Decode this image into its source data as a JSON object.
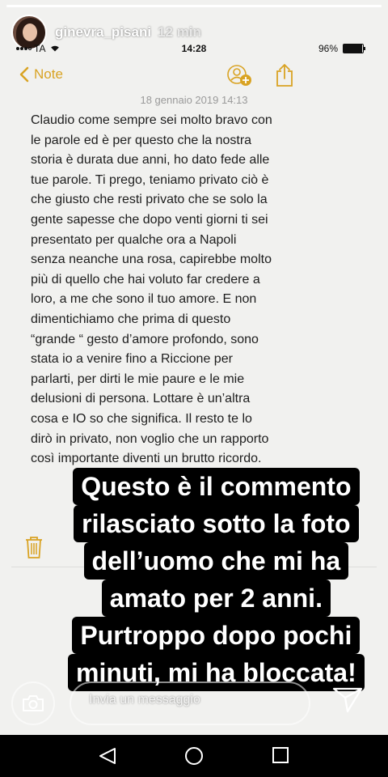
{
  "story": {
    "progress": 1.0,
    "username": "ginevra_pisani",
    "time_ago": "12 min"
  },
  "statusbar": {
    "carrier": "TA",
    "time": "14:28",
    "battery_percent": "96%",
    "battery_level": 0.96
  },
  "notes": {
    "back_label": "Note",
    "date": "18 gennaio 2019 14:13",
    "body_lines": [
      "Claudio come sempre sei molto bravo con",
      "le parole ed è per questo che la nostra",
      "storia è durata due anni, ho dato fede alle",
      "tue parole. Ti prego, teniamo privato ciò è",
      "che giusto che resti privato che se solo la",
      "gente sapesse che dopo venti giorni ti sei",
      "presentato per qualche ora a Napoli",
      "senza neanche una rosa, capirebbe molto",
      "più di quello che hai voluto far credere a",
      "loro, a me che sono il tuo amore. E non",
      "dimentichiamo che prima di questo",
      "“grande “ gesto d’amore profondo, sono",
      "stata io a venire fino a Riccione per",
      "parlarti, per dirti le mie paure e le mie",
      "delusioni di persona. Lottare è un’altra",
      "cosa e IO so che significa. Il resto te lo",
      "dirò in privato, non voglio che un rapporto",
      "così importante diventi un brutto ricordo."
    ],
    "accent_color": "#d9a323"
  },
  "caption": {
    "lines": [
      "Questo è il commento",
      "rilasciato sotto la foto",
      "dell’uomo che mi ha",
      "amato per 2 anni.",
      "Purtroppo dopo pochi",
      "minuti, mi ha bloccata!"
    ]
  },
  "reply": {
    "placeholder": "Invia un messaggio"
  },
  "icons": {
    "back": "chevron-left-icon",
    "add_people": "add-people-icon",
    "share": "share-icon",
    "trash": "trash-icon",
    "camera": "camera-icon",
    "send": "send-icon"
  }
}
